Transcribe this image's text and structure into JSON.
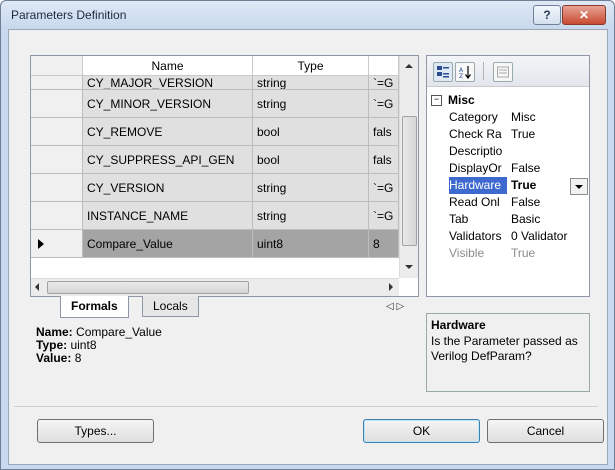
{
  "window": {
    "title": "Parameters Definition",
    "help_label": "?",
    "close_label": "✕"
  },
  "grid": {
    "columns": [
      "Name",
      "Type",
      ""
    ],
    "rows": [
      {
        "name": "CY_MAJOR_VERSION",
        "type": "string",
        "value": "`=G"
      },
      {
        "name": "CY_MINOR_VERSION",
        "type": "string",
        "value": "`=G"
      },
      {
        "name": "CY_REMOVE",
        "type": "bool",
        "value": "fals"
      },
      {
        "name": "CY_SUPPRESS_API_GEN",
        "type": "bool",
        "value": "fals"
      },
      {
        "name": "CY_VERSION",
        "type": "string",
        "value": "`=G"
      },
      {
        "name": "INSTANCE_NAME",
        "type": "string",
        "value": "`=G"
      },
      {
        "name": "Compare_Value",
        "type": "uint8",
        "value": "8",
        "selected": true
      }
    ]
  },
  "tabs": {
    "active": "Formals",
    "inactive": "Locals",
    "nav": "◁ ▷"
  },
  "summary": {
    "name_label": "Name:",
    "name_value": "Compare_Value",
    "type_label": "Type:",
    "type_value": "uint8",
    "value_label": "Value:",
    "value_value": "8"
  },
  "properties": {
    "category": "Misc",
    "rows": [
      {
        "name": "Category",
        "value": "Misc"
      },
      {
        "name": "Check Ra",
        "value": "True"
      },
      {
        "name": "Descriptio",
        "value": ""
      },
      {
        "name": "DisplayOr",
        "value": "False"
      },
      {
        "name": "Hardware",
        "value": "True",
        "selected": true
      },
      {
        "name": "Read Onl",
        "value": "False"
      },
      {
        "name": "Tab",
        "value": "Basic"
      },
      {
        "name": "Validators",
        "value": "0 Validator"
      },
      {
        "name": "Visible",
        "value": "True",
        "dim": true
      }
    ],
    "description_title": "Hardware",
    "description_text": "Is the Parameter passed as Verilog DefParam?"
  },
  "buttons": {
    "types": "Types...",
    "ok": "OK",
    "cancel": "Cancel"
  },
  "icons": {
    "categorized": "categorized-icon",
    "alphabetical": "sort-az-icon",
    "pages": "property-pages-icon"
  }
}
